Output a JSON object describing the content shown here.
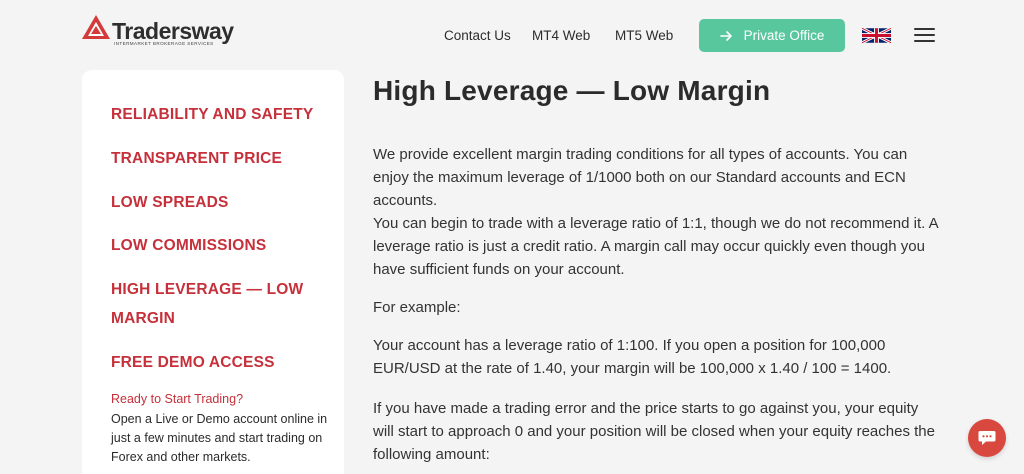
{
  "header": {
    "logo_text": "Tradersway",
    "logo_sub": "INTERMARKET BROKERAGE SERVICES",
    "nav": [
      {
        "label": "Contact Us"
      },
      {
        "label": "MT4 Web"
      },
      {
        "label": "MT5 Web"
      }
    ],
    "private_office_label": "Private Office"
  },
  "sidebar": {
    "items": [
      {
        "label": "RELIABILITY AND SAFETY"
      },
      {
        "label": "TRANSPARENT PRICE"
      },
      {
        "label": "LOW SPREADS"
      },
      {
        "label": "LOW COMMISSIONS"
      },
      {
        "label": "HIGH LEVERAGE — LOW MARGIN"
      },
      {
        "label": "FREE DEMO ACCESS"
      }
    ],
    "cta_title": "Ready to Start Trading?",
    "cta_text": "Open a Live or Demo account online in just a few minutes and start trading on Forex and other markets."
  },
  "main": {
    "title": "High Leverage — Low Margin",
    "paragraphs": [
      "We provide excellent margin trading conditions for all types of accounts. You can enjoy the maximum leverage of 1/1000 both on our Standard accounts and ECN accounts.",
      "You can begin to trade with a leverage ratio of 1:1, though we do not recommend it. A leverage ratio is just a credit ratio. A margin call may occur quickly even though you have sufficient funds on your account.",
      "For example:",
      "Your account has a leverage ratio of 1:100. If you open a position for 100,000 EUR/USD at the rate of 1.40, your margin will be 100,000 x 1.40 / 100 = 1400.",
      "If you have made a trading error and the price starts to go against you, your equity will start to approach 0 and your position will be closed when your equity reaches the following amount:"
    ]
  },
  "colors": {
    "accent_red": "#c6303a",
    "button_green": "#58c79d",
    "chat_red": "#d9483f"
  }
}
